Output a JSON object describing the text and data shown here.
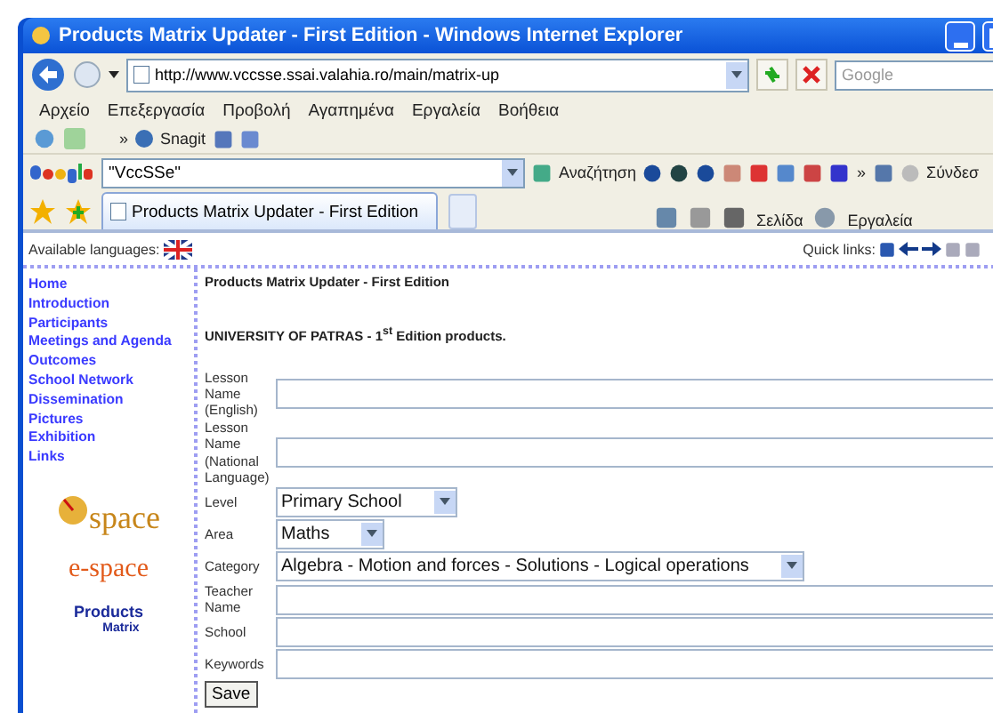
{
  "window": {
    "title": "Products Matrix Updater - First Edition - Windows Internet Explorer"
  },
  "address_bar": {
    "url": "http://www.vccsse.ssai.valahia.ro/main/matrix-up"
  },
  "search_box": {
    "placeholder": "Google"
  },
  "menu": [
    "Αρχείο",
    "Επεξεργασία",
    "Προβολή",
    "Αγαπημένα",
    "Εργαλεία",
    "Βοήθεια"
  ],
  "links_toolbar": {
    "chevron": "»",
    "item": "Snagit"
  },
  "google_toolbar": {
    "query": "\"VccSSe\"",
    "search_label": "Αναζήτηση",
    "chevron": "»",
    "sign_in": "Σύνδεσ"
  },
  "tab": {
    "title": "Products Matrix Updater - First Edition"
  },
  "command_bar": {
    "page": "Σελίδα",
    "tools": "Εργαλεία"
  },
  "page": {
    "languages_label": "Available languages:",
    "quick_links_label": "Quick links:",
    "nav": [
      "Home",
      "Introduction",
      "Participants",
      "Meetings and Agenda",
      "Outcomes",
      "School Network",
      "Dissemination",
      "Pictures",
      "Exhibition",
      "Links"
    ],
    "logos": [
      {
        "kind": "espace",
        "text": "space"
      },
      {
        "kind": "espace2",
        "text": "e-space"
      },
      {
        "kind": "products",
        "text": "Products",
        "subtext": "Matrix"
      }
    ],
    "heading": "Products Matrix Updater - First Edition",
    "subheading": "UNIVERSITY OF PATRAS - 1$^{st}$ Edition products.",
    "fields": [
      {
        "kind": "text",
        "label": "Lesson Name (English)"
      },
      {
        "kind": "text",
        "label": "Lesson Name (National Language)"
      },
      {
        "kind": "select",
        "label": "Level",
        "value": "Primary School"
      },
      {
        "kind": "select",
        "label": "Area",
        "value": "Maths"
      },
      {
        "kind": "select",
        "label": "Category",
        "value": "Algebra - Motion and forces - Solutions - Logical operations"
      },
      {
        "kind": "text",
        "label": "Teacher Name"
      },
      {
        "kind": "text",
        "label": "School"
      },
      {
        "kind": "text",
        "label": "Keywords"
      }
    ],
    "save_button": "Save"
  }
}
